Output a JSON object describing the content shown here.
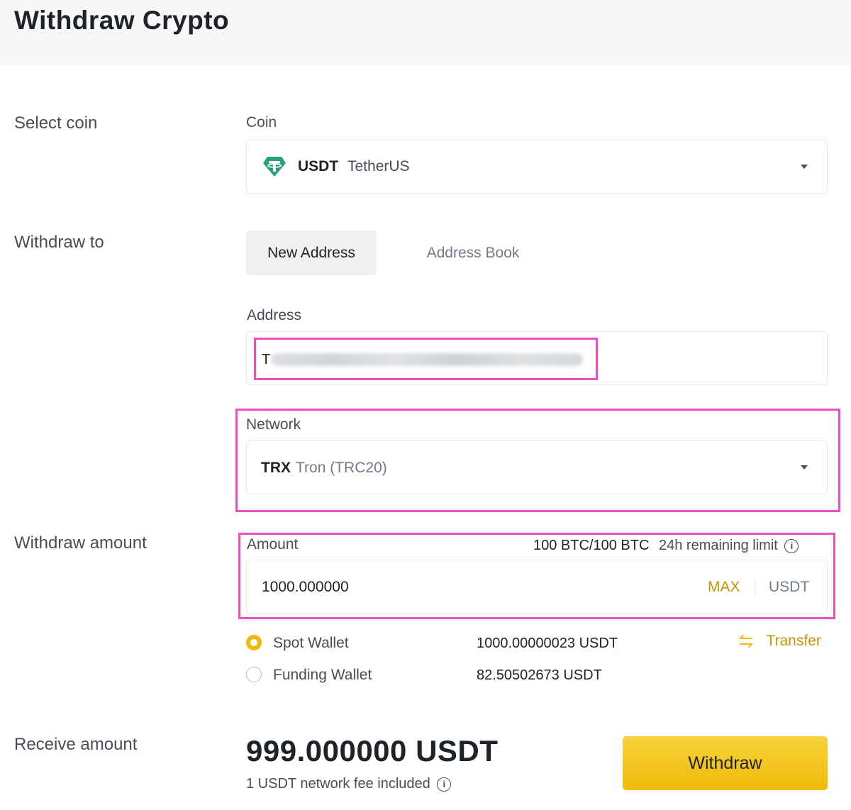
{
  "page": {
    "title": "Withdraw Crypto"
  },
  "sections": {
    "select_coin": "Select coin",
    "withdraw_to": "Withdraw to",
    "withdraw_amount": "Withdraw amount",
    "receive_amount": "Receive amount"
  },
  "coin": {
    "label": "Coin",
    "symbol": "USDT",
    "name": "TetherUS",
    "icon": "tether-icon",
    "icon_color": "#26a17b"
  },
  "withdraw_to": {
    "tabs": [
      "New Address",
      "Address Book"
    ],
    "active_tab": "New Address"
  },
  "address": {
    "label": "Address",
    "value_prefix": "T"
  },
  "network": {
    "label": "Network",
    "symbol": "TRX",
    "name": "Tron (TRC20)"
  },
  "amount": {
    "label": "Amount",
    "limit_value": "100 BTC/100 BTC",
    "limit_label": "24h remaining limit",
    "value": "1000.000000",
    "max_label": "MAX",
    "unit": "USDT"
  },
  "wallets": [
    {
      "name": "Spot Wallet",
      "balance": "1000.00000023 USDT",
      "selected": true
    },
    {
      "name": "Funding Wallet",
      "balance": "82.50502673 USDT",
      "selected": false
    }
  ],
  "transfer_label": "Transfer",
  "receive": {
    "amount": "999.000000 USDT",
    "fee_note": "1 USDT network fee included"
  },
  "withdraw_button": "Withdraw",
  "colors": {
    "accent": "#f0b90b",
    "accent_text": "#c99400",
    "highlight": "#f04fc1"
  }
}
